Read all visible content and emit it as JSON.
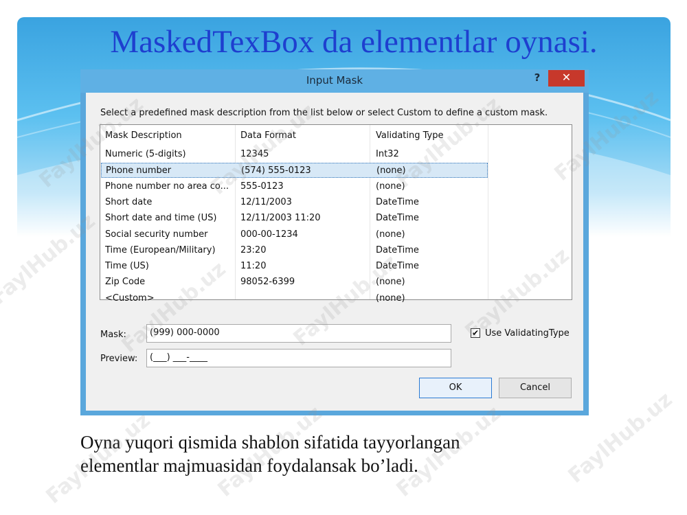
{
  "slide": {
    "title": "MaskedTexBox da elementlar oynasi.",
    "body_line1": "Oyna yuqori qismida shablon sifatida tayyorlangan",
    "body_line2": "elementlar majmuasidan foydalansak bo’ladi.",
    "watermark": "FaylHub.uz"
  },
  "dialog": {
    "title": "Input Mask",
    "help_glyph": "?",
    "close_glyph": "✕",
    "instruction": "Select a predefined mask description from the list below or select Custom to define a custom mask.",
    "columns": [
      "Mask Description",
      "Data Format",
      "Validating Type"
    ],
    "rows": [
      {
        "desc": "Numeric (5-digits)",
        "format": "12345",
        "type": "Int32",
        "selected": false
      },
      {
        "desc": "Phone number",
        "format": "(574) 555-0123",
        "type": "(none)",
        "selected": true
      },
      {
        "desc": "Phone number no area co...",
        "format": "555-0123",
        "type": "(none)",
        "selected": false
      },
      {
        "desc": "Short date",
        "format": "12/11/2003",
        "type": "DateTime",
        "selected": false
      },
      {
        "desc": "Short date and time (US)",
        "format": "12/11/2003 11:20",
        "type": "DateTime",
        "selected": false
      },
      {
        "desc": "Social security number",
        "format": "000-00-1234",
        "type": "(none)",
        "selected": false
      },
      {
        "desc": "Time (European/Military)",
        "format": "23:20",
        "type": "DateTime",
        "selected": false
      },
      {
        "desc": "Time (US)",
        "format": "11:20",
        "type": "DateTime",
        "selected": false
      },
      {
        "desc": "Zip Code",
        "format": "98052-6399",
        "type": "(none)",
        "selected": false
      },
      {
        "desc": "<Custom>",
        "format": "",
        "type": "(none)",
        "selected": false
      }
    ],
    "mask_label": "Mask:",
    "mask_value": "(999) 000-0000",
    "preview_label": "Preview:",
    "preview_value": "(___) ___-____",
    "use_validating_label": "Use ValidatingType",
    "use_validating_checked": true,
    "check_glyph": "✔",
    "ok_label": "OK",
    "cancel_label": "Cancel"
  },
  "colors": {
    "title_blue": "#1e3fcf",
    "dialog_frame": "#5aa7dc",
    "close_red": "#c7382b",
    "selection": "#d7e8f6"
  }
}
